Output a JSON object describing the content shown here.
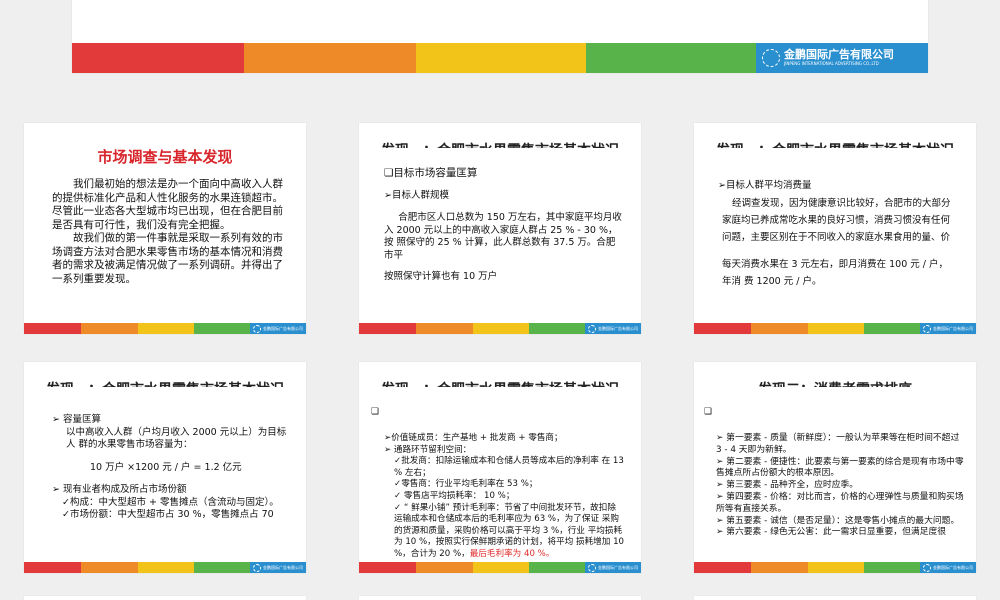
{
  "logo": {
    "name": "金鹏国际广告有限公司",
    "sub": "JINPENG INTERNATIONAL ADVERTISING CO.,LTD"
  },
  "slide1": {
    "title": "市场调查与基本发现",
    "p1": "我们最初始的想法是办一个面向中高收入人群的提供标准化产品和人性化服务的水果连锁超市。尽管此一业态各大型城市均已出现，但在合肥目前是否具有可行性，我们没有完全把握。",
    "p2": "故我们做的第一件事就是采取一系列有效的市场调查方法对合肥水果零售市场的基本情况和消费者的需求及被满足情况做了一系列调研。并得出了一系列重要发现。"
  },
  "slide2": {
    "heading": "发现一：合肥市水果零售市场基本状况",
    "h1": "❏目标市场容量匡算",
    "h2": "➢目标人群规模",
    "p1": "合肥市区人口总数为 150 万左右，其中家庭平均月收 入 2000 元以上的中高收入家庭人群占 25 % - 30 %，按 照保守的 25 % 计算，此人群总数有 37.5 万。合肥市平",
    "p2": "按照保守计算也有 10 万户"
  },
  "slide3": {
    "heading": "发现一：合肥市水果零售市场基本状况",
    "h1": "➢目标人群平均消费量",
    "l1": "经调查发现，因为健康意识比较好，合肥市的大部分",
    "l2": "家庭均已养成常吃水果的良好习惯，消费习惯没有任何",
    "l3": "问题，主要区别在于不同收入的家庭水果食用的量、价",
    "l4": "每天消费水果在 3 元左右，即月消费在 100 元 / 户，",
    "l5": "年消 费 1200 元 / 户。"
  },
  "slide4": {
    "heading": "发现一：合肥市水果零售市场基本状况",
    "h1": "➢ 容量匡算",
    "p1": "以中高收入人群（户均月收入 2000 元以上）为目标人 群的水果零售市场容量为：",
    "formula": "10 万户 ×1200 元 / 户 = 1.2 亿元",
    "h2": "➢ 现有业者构成及所占市场份额",
    "l1": "✓构成：中大型超市 + 零售摊点（含流动与固定）。",
    "l2": "✓市场份额：中大型超市占 30 %，零售摊点占 70"
  },
  "slide5": {
    "heading": "发现一：合肥市水果零售市场基本状况",
    "marker": "❏",
    "l1": "➢价值链成员：生产基地 + 批发商 + 零售商；",
    "l2": "➢ 通路环节留利空间：",
    "l3": "✓批发商：扣除运输成本和仓储人员等成本后的净利率 在 13 % 左右；",
    "l4": "✓零售商：行业平均毛利率在 53 %；",
    "l5": "✓ 零售店平均损耗率： 10 %；",
    "l6": "✓ “ 鲜果小铺” 预计毛利率：节省了中间批发环节，故扣除 运输成本和仓储成本后的毛利率应为 63 %，为了保证 采购的货源和质量，采购价格可以高于平均 3 %，行业 平均损耗为 10 %，按照实行保鲜期承诺的计划，将平均 损耗增加 10 %，合计为 20 %，",
    "l6_red": "最后毛利率为 40 %。"
  },
  "slide6": {
    "heading": "发现二：消费者需求排序",
    "marker": "❏",
    "l1": "➢ 第一要素 - 质量（新鲜度）：一般认为苹果等在柜时间不超过 3 - 4 天即为新鲜。",
    "l2": "➢ 第二要素 - 便捷性：此要素与第一要素的综合是现有市场中零售摊点所占份额大的根本原因。",
    "l3": "➢ 第三要素 - 品种齐全，应时应季。",
    "l4": "➢ 第四要素 - 价格：对比而言，价格的心理弹性与质量和购买场所等有直接关系。",
    "l5": "➢ 第五要素 - 诚信（是否足量）：这是零售小摊点的最大问题。",
    "l6": "➢ 第六要素 - 绿色无公害：此一需求日显重要，但满足度很"
  }
}
